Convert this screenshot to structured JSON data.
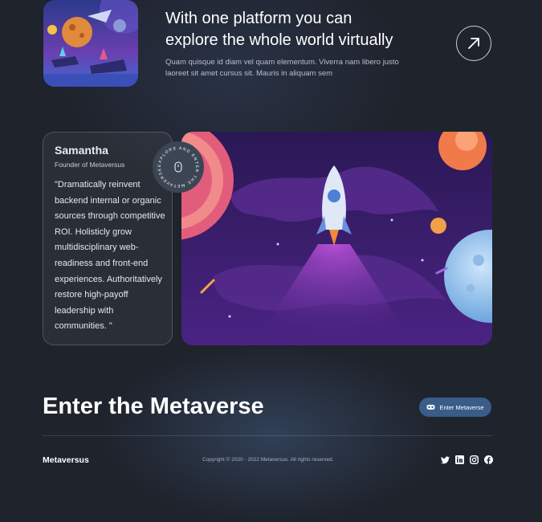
{
  "feature": {
    "title_line1": "With one platform you can",
    "title_line2": "explore the whole world virtually",
    "description": "Quam quisque id diam vel quam elementum. Viverra nam libero justo laoreet sit amet cursus sit. Mauris in aliquam sem",
    "arrow_icon": "arrow-up-right-icon"
  },
  "testimonial": {
    "name": "Samantha",
    "role": "Founder of Metaversus",
    "quote": "\"Dramatically reinvent backend internal or organic sources through competitive ROI. Holisticly grow multidisciplinary web-readiness and front-end experiences. Authoritatively restore high-payoff leadership with communities. \"",
    "badge_text": "EXPLORE AND ENTER THE METAVERSE"
  },
  "cta": {
    "title": "Enter the Metaverse",
    "button_label": "Enter Metaverse",
    "button_icon": "headset-icon"
  },
  "footer": {
    "brand": "Metaversus",
    "copyright": "Copyright © 2020 - 2022 Metaversus. All rights reserved.",
    "social_icons": [
      "twitter-icon",
      "linkedin-icon",
      "instagram-icon",
      "facebook-icon"
    ]
  },
  "colors": {
    "background": "#1f232c",
    "button": "#3a5c89",
    "accent_purple": "#5b2a8c"
  }
}
